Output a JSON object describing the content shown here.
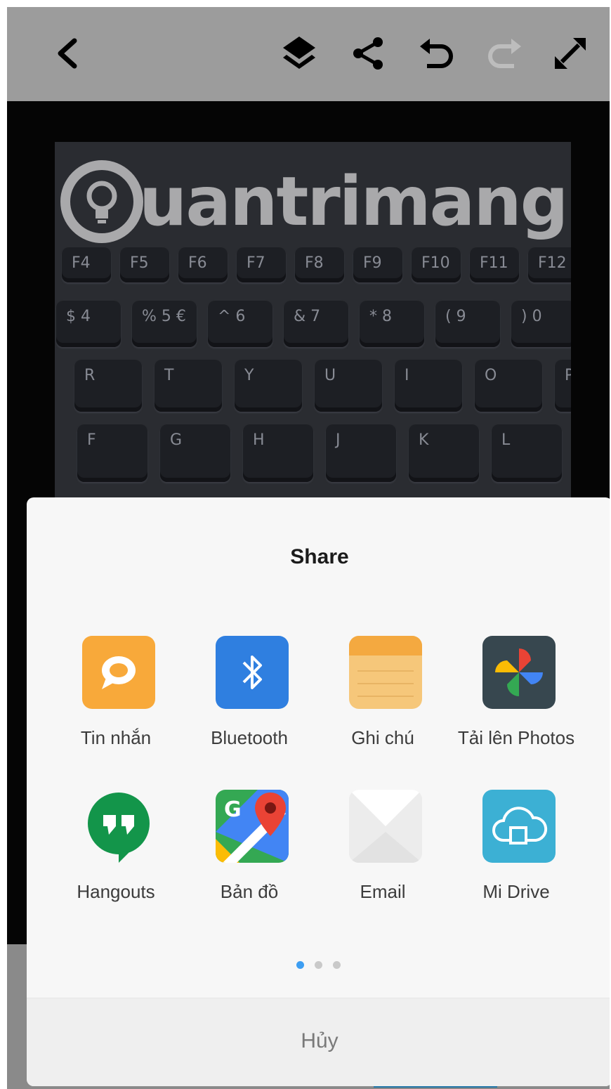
{
  "toolbar": {
    "icons": [
      "back-arrow-icon",
      "layers-icon",
      "share-icon",
      "undo-icon",
      "redo-icon",
      "expand-icon"
    ]
  },
  "photo": {
    "watermark": "uantrimang",
    "keys_row1": [
      "F4",
      "F5",
      "F6",
      "F7",
      "F8",
      "F9",
      "F10",
      "F11",
      "F12"
    ],
    "keys_row2": [
      "$ 4",
      "% 5 €",
      "^ 6",
      "& 7",
      "* 8",
      "( 9",
      ") 0"
    ],
    "keys_row3": [
      "R",
      "T",
      "Y",
      "U",
      "I",
      "O",
      "P"
    ],
    "keys_row4": [
      "F",
      "G",
      "H",
      "J",
      "K",
      "L"
    ]
  },
  "share_sheet": {
    "title": "Share",
    "apps": [
      {
        "label": "Tin nhắn",
        "icon": "messages-icon",
        "color": "#f8a93a"
      },
      {
        "label": "Bluetooth",
        "icon": "bluetooth-icon",
        "color": "#2f7fe0"
      },
      {
        "label": "Ghi chú",
        "icon": "notes-icon",
        "color": "#f6c77a"
      },
      {
        "label": "Tải lên Photos",
        "icon": "google-photos-icon",
        "color": "#37474f"
      },
      {
        "label": "Hangouts",
        "icon": "hangouts-icon",
        "color": "#13954a"
      },
      {
        "label": "Bản đồ",
        "icon": "google-maps-icon",
        "color": "#34a853"
      },
      {
        "label": "Email",
        "icon": "email-icon",
        "color": "#e8e8e8"
      },
      {
        "label": "Mi Drive",
        "icon": "mi-drive-icon",
        "color": "#3cb0d4"
      }
    ],
    "page_indicator": {
      "total": 3,
      "current": 1
    },
    "cancel_label": "Hủy"
  }
}
